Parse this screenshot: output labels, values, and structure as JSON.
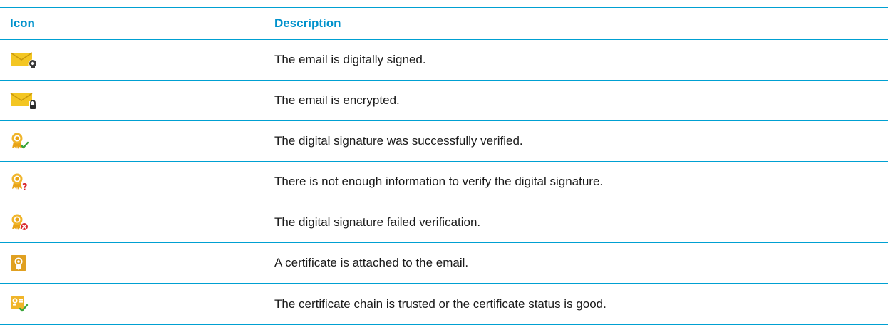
{
  "header": {
    "icon_col": "Icon",
    "desc_col": "Description"
  },
  "rows": [
    {
      "icon": "email-signed-icon",
      "description": "The email is digitally signed."
    },
    {
      "icon": "email-encrypted-icon",
      "description": "The email is encrypted."
    },
    {
      "icon": "signature-verified-icon",
      "description": "The digital signature was successfully verified."
    },
    {
      "icon": "signature-unknown-icon",
      "description": "There is not enough information to verify the digital signature."
    },
    {
      "icon": "signature-failed-icon",
      "description": "The digital signature failed verification."
    },
    {
      "icon": "certificate-attached-icon",
      "description": "A certificate is attached to the email."
    },
    {
      "icon": "certificate-trusted-icon",
      "description": "The certificate chain is trusted or the certificate status is good."
    }
  ],
  "colors": {
    "accent": "#00a0d2",
    "envelope": "#f3c623",
    "badge": "#e8a317",
    "check": "#3aa53a",
    "question": "#d9262b",
    "error": "#d9262b"
  }
}
